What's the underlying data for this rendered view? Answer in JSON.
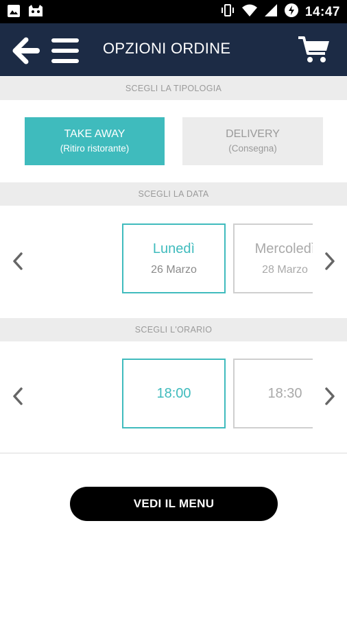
{
  "status_bar": {
    "time": "14:47",
    "left_icons": [
      "image-icon",
      "android-debug-icon"
    ],
    "right_icons": [
      "vibrate-icon",
      "wifi-icon",
      "signal-icon",
      "battery-charging-icon"
    ]
  },
  "app_bar": {
    "title": "OPZIONI ORDINE",
    "icons": [
      "back-arrow-icon",
      "hamburger-menu-icon",
      "shopping-cart-icon"
    ]
  },
  "type_section": {
    "header": "SCEGLI LA TIPOLOGIA",
    "options": [
      {
        "title": "TAKE AWAY",
        "subtitle": "(Ritiro ristorante)",
        "selected": true
      },
      {
        "title": "DELIVERY",
        "subtitle": "(Consegna)",
        "selected": false
      }
    ]
  },
  "date_section": {
    "header": "SCEGLI LA DATA",
    "items": [
      {
        "day": "Lunedì",
        "date": "26 Marzo",
        "selected": true
      },
      {
        "day": "Mercoledì",
        "date": "28 Marzo",
        "selected": false
      }
    ]
  },
  "time_section": {
    "header": "SCEGLI L'ORARIO",
    "items": [
      {
        "time": "18:00",
        "selected": true
      },
      {
        "time": "18:30",
        "selected": false
      }
    ]
  },
  "cta": {
    "label": "VEDI IL MENU"
  },
  "colors": {
    "app_bar": "#1c2b45",
    "accent": "#3fbbbd",
    "section_bg": "#ececec",
    "cta_bg": "#000000"
  }
}
